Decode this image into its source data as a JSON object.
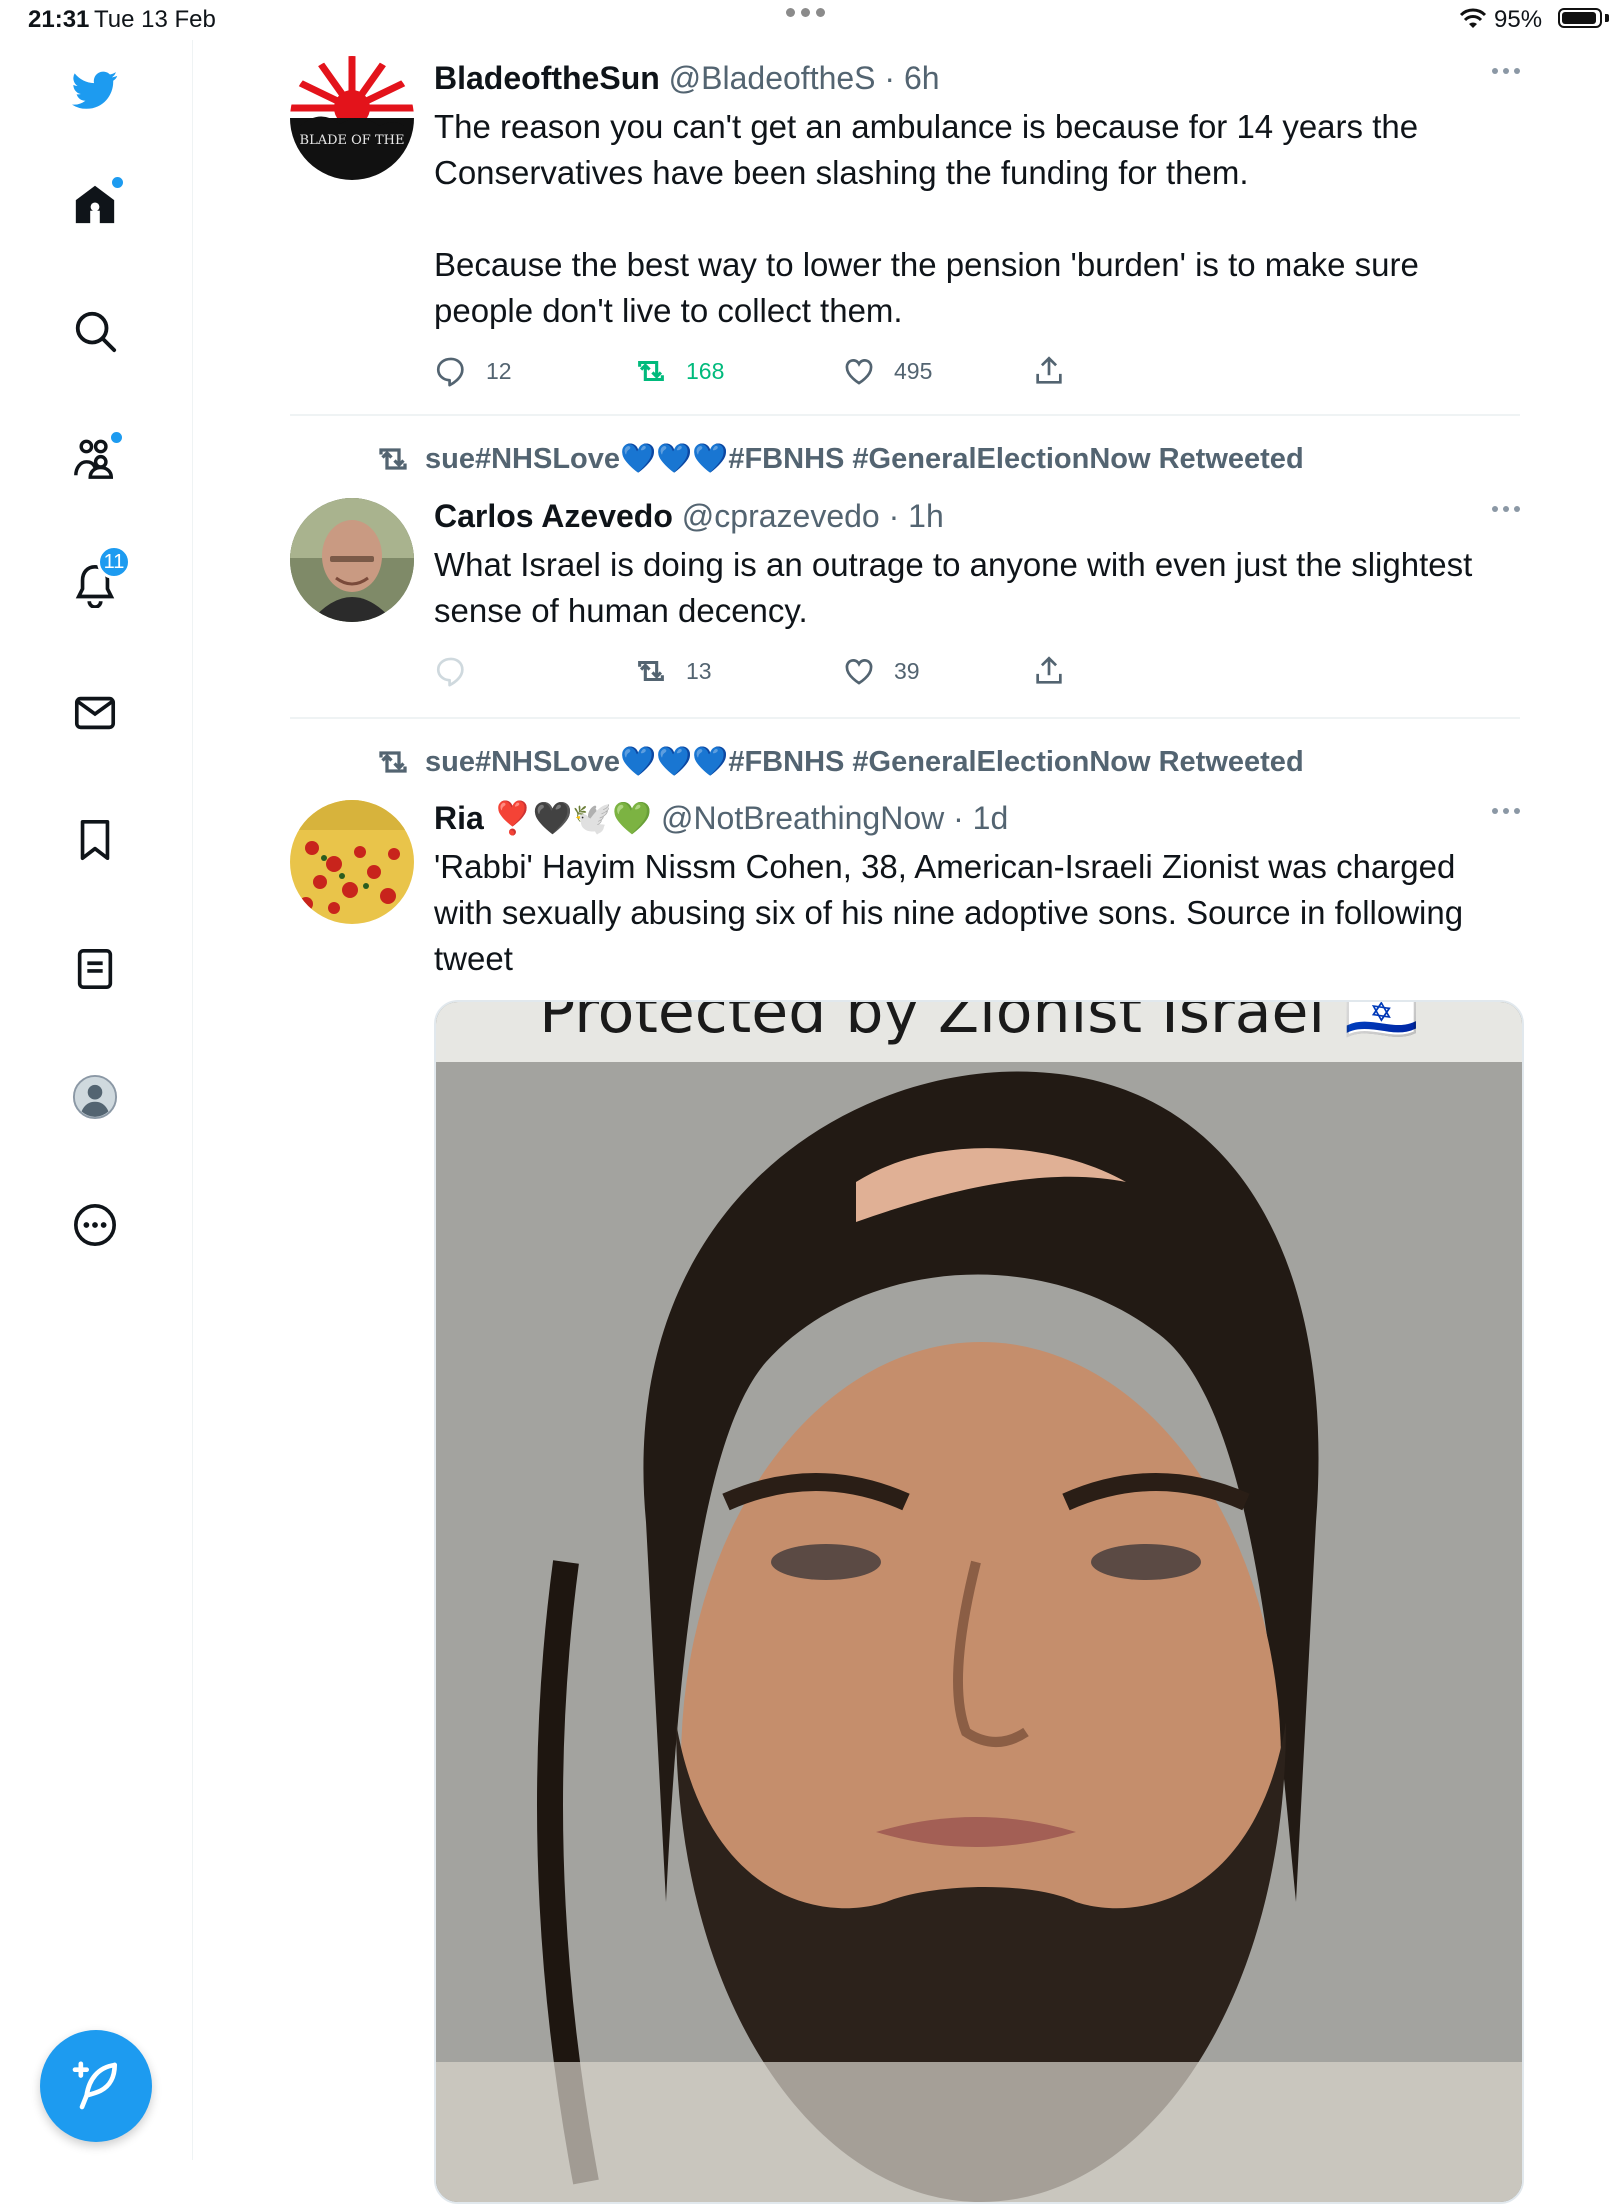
{
  "status_bar": {
    "time": "21:31",
    "date": "Tue 13 Feb",
    "battery_pct": "95%",
    "battery_level": 0.95
  },
  "sidebar": {
    "items": [
      {
        "icon": "twitter-logo-icon"
      },
      {
        "icon": "home-icon",
        "has_dot": true
      },
      {
        "icon": "search-icon"
      },
      {
        "icon": "communities-icon",
        "has_dot": true
      },
      {
        "icon": "notifications-icon",
        "badge": "11"
      },
      {
        "icon": "messages-icon"
      },
      {
        "icon": "bookmarks-icon"
      },
      {
        "icon": "lists-icon"
      },
      {
        "icon": "profile-icon"
      },
      {
        "icon": "more-icon"
      }
    ],
    "compose_icon": "compose-tweet-icon"
  },
  "colors": {
    "accent": "#1d9bf0",
    "retweet_active": "#00ba7c",
    "text_secondary": "#536471"
  },
  "tweets": [
    {
      "name": "BladeoftheSun",
      "handle": "@BladeoftheS",
      "time": "6h",
      "text_p1": "The reason you can't get an ambulance is because for 14 years the Conservatives have been slashing the funding for them.",
      "text_p2": "Because the best way to lower the pension 'burden' is to make sure people don't live to collect them.",
      "avatar_text": "BLADE OF THE",
      "replies": "12",
      "retweets": "168",
      "likes": "495"
    },
    {
      "retweeted_by": "sue#NHSLove💙💙💙#FBNHS #GeneralElectionNow Retweeted",
      "name": "Carlos Azevedo",
      "handle": "@cprazevedo",
      "time": "1h",
      "text": "What Israel is doing is an outrage to anyone with even just the slightest sense of human decency.",
      "replies": "",
      "retweets": "13",
      "likes": "39"
    },
    {
      "retweeted_by": "sue#NHSLove💙💙💙#FBNHS #GeneralElectionNow Retweeted",
      "name": "Ria",
      "name_emoji": "❣️🖤🕊️💚",
      "handle": "@NotBreathingNow",
      "time": "1d",
      "text": "'Rabbi' Hayim Nissm Cohen, 38, American-Israeli Zionist was charged with sexually abusing six of his nine adoptive sons. Source in following tweet",
      "media_caption": "Protected by Zionist Israel 🇮🇱"
    }
  ]
}
